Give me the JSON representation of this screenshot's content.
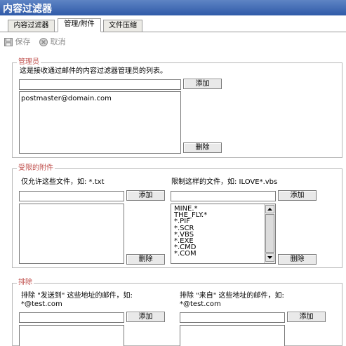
{
  "window": {
    "title": "内容过滤器"
  },
  "tabs": [
    {
      "label": "内容过滤器"
    },
    {
      "label": "管理/附件"
    },
    {
      "label": "文件压缩"
    }
  ],
  "toolbar": {
    "save_label": "保存",
    "cancel_label": "取消"
  },
  "administrators": {
    "legend": "管理员",
    "description": "这是接收通过邮件的内容过滤器管理员的列表。",
    "input_value": "",
    "add_label": "添加",
    "delete_label": "删除",
    "items": [
      "postmaster@domain.com"
    ]
  },
  "attachments": {
    "legend": "受限的附件",
    "allow_label": "仅允许这些文件，如: *.txt",
    "allow_input_value": "",
    "allow_add_label": "添加",
    "allow_delete_label": "删除",
    "allow_items": [],
    "restrict_label": "限制这样的文件，如: ILOVE*.vbs",
    "restrict_input_value": "",
    "restrict_add_label": "添加",
    "restrict_delete_label": "删除",
    "restrict_items": [
      "MINE.*",
      "THE_FLY.*",
      "*.PIF",
      "*.SCR",
      "*.VBS",
      "*.EXE",
      "*.CMD",
      "*.COM"
    ]
  },
  "exclusions": {
    "legend": "排除",
    "sent_to_label_1": "排除 \"发送到\" 这些地址的邮件，如:",
    "sent_to_label_2": "*@test.com",
    "sent_to_add_label": "添加",
    "from_label_1": "排除 \"来自\" 这些地址的邮件，如:",
    "from_label_2": "*@test.com",
    "from_add_label": "添加"
  },
  "colors": {
    "title_bar": "#2f5aa8",
    "legend_text": "#c0504d"
  }
}
